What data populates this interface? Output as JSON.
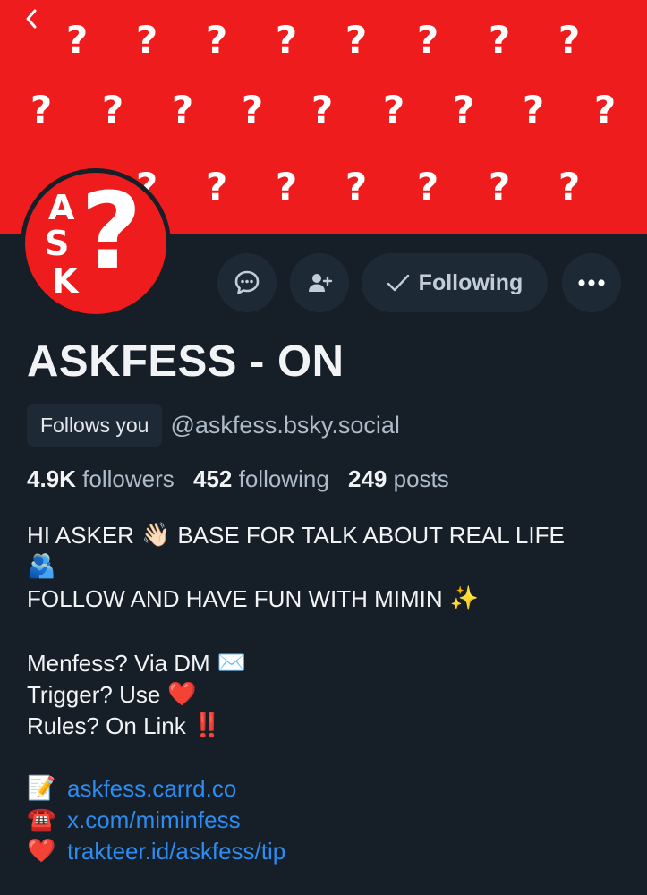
{
  "profile": {
    "display_name": "ASKFESS - ON",
    "follows_you": "Follows you",
    "handle": "@askfess.bsky.social",
    "avatar_letters": [
      "A",
      "S",
      "K"
    ],
    "avatar_mark": "?"
  },
  "banner": {
    "symbol": "?",
    "color": "#ee1c1c"
  },
  "actions": {
    "following_label": "Following"
  },
  "stats": {
    "followers_count": "4.9K",
    "followers_label": "followers",
    "following_count": "452",
    "following_label": "following",
    "posts_count": "249",
    "posts_label": "posts"
  },
  "bio": {
    "line1_a": "HI ASKER",
    "line1_emoji": "👋🏻",
    "line1_b": "BASE FOR TALK ABOUT REAL LIFE",
    "line2_emoji": "🫂",
    "line3": "FOLLOW AND HAVE FUN WITH MIMIN",
    "line3_emoji": "✨",
    "line4": "Menfess? Via DM",
    "line4_emoji": "✉️",
    "line5": "Trigger? Use",
    "line5_emoji": "❤️",
    "line6": "Rules? On Link",
    "line6_emoji": "‼️",
    "links": [
      {
        "emoji": "📝",
        "text": "askfess.carrd.co"
      },
      {
        "emoji": "☎️",
        "text": "x.com/miminfess"
      },
      {
        "emoji": "❤️",
        "text": "trakteer.id/askfess/tip"
      }
    ]
  },
  "colors": {
    "background": "#161e27",
    "link": "#2d8cf0",
    "button": "#1e2936"
  }
}
